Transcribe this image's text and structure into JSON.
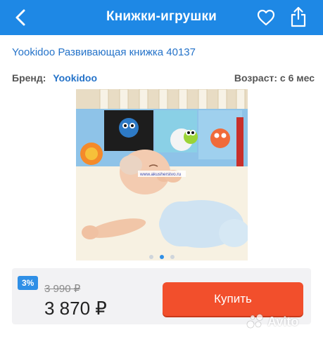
{
  "header": {
    "title": "Книжки-игрушки",
    "back_icon": "chevron-left-icon",
    "favorite_icon": "heart-icon",
    "share_icon": "share-icon",
    "color": "#1e88e5"
  },
  "product": {
    "title": "Yookidoo Развивающая книжка 40137",
    "brand_label": "Бренд:",
    "brand": "Yookidoo",
    "age": "Возраст: с 6 мес",
    "watermark": "www.akusherstvo.ru"
  },
  "gallery": {
    "dot_count": 3,
    "active_index": 1
  },
  "pricing": {
    "discount": "3%",
    "old_price": "3 990 ₽",
    "price": "3 870 ₽",
    "buy_label": "Купить",
    "buy_color": "#f24f2c"
  },
  "watermark_brand": "Avito"
}
